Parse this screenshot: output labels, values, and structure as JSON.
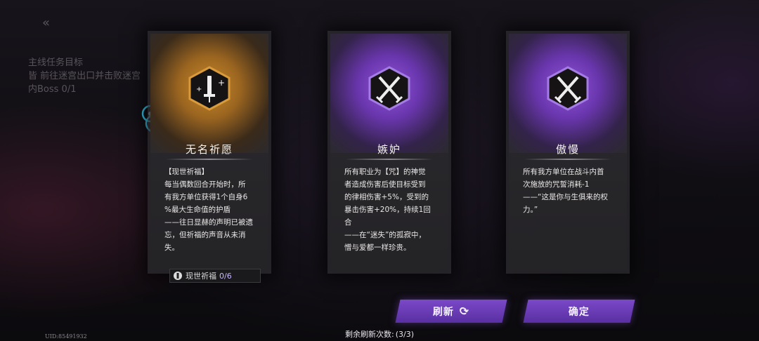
{
  "background": {
    "back_icon": "chevron-left-double-icon",
    "quest_lines": [
      "主线任务目标",
      "皆 前往迷宫出口并击败迷宫",
      "内Boss 0/1"
    ]
  },
  "uid": "UID:85491932",
  "cards": [
    {
      "title": "无名祈愿",
      "theme": "gold",
      "icon": "syringe-plus-icon",
      "description": "【现世祈福】\n每当偶数回合开始时，所\n有我方单位获得1个自身6\n%最大生命值的护盾\n——往日显赫的声明已被遗\n忘，但祈福的声音从未消\n失。"
    },
    {
      "title": "嫉妒",
      "theme": "purple",
      "icon": "crossed-swords-icon",
      "description": "所有职业为【咒】的神觉\n者造成伤害后使目标受到\n的律相伤害+5%，受到的\n暴击伤害+20%，持续1回\n合\n——在“迷失”的孤寂中，\n憎与爱都一样珍贵。"
    },
    {
      "title": "傲慢",
      "theme": "purple",
      "icon": "crossed-swords-icon",
      "description": "所有我方单位在战斗内首\n次施放的咒誓消耗-1\n——“这是你与生俱来的权\n力。”"
    }
  ],
  "blessing_counter": {
    "label": "现世祈福",
    "value": "0/6",
    "icon": "blessing-icon"
  },
  "buttons": {
    "refresh": "刷新",
    "confirm": "确定"
  },
  "remaining": {
    "label": "剩余刷新次数:",
    "value": "(3/3)"
  },
  "colors": {
    "gold": "#c98a2a",
    "purple": "#7a49c8",
    "card_bg": "#2b2a2e"
  }
}
